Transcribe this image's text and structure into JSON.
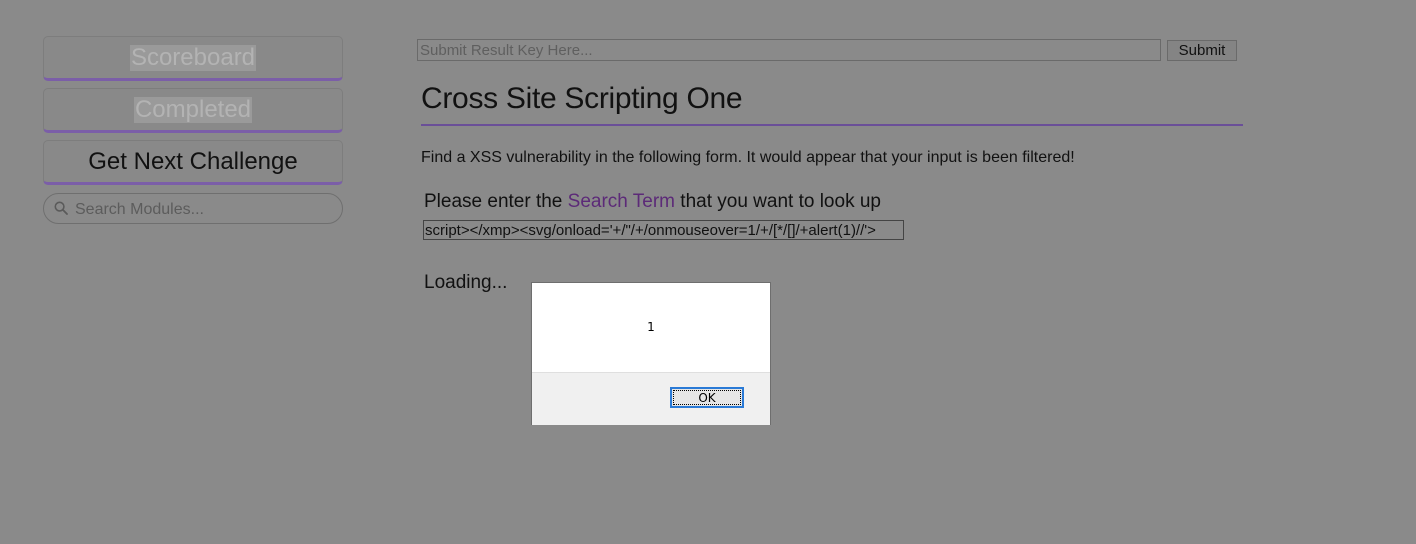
{
  "sidebar": {
    "scoreboard_label": "Scoreboard",
    "completed_label": "Completed",
    "next_challenge_label": "Get Next Challenge",
    "search_placeholder": "Search Modules...",
    "search_icon": "magnifier-icon"
  },
  "result_bar": {
    "placeholder": "Submit Result Key Here...",
    "submit_label": "Submit"
  },
  "challenge": {
    "title": "Cross Site Scripting One",
    "description": "Find a XSS vulnerability in the following form. It would appear that your input is been filtered!",
    "prompt_before": "Please enter the ",
    "prompt_highlight": "Search Term",
    "prompt_after": " that you want to look up",
    "input_value": "script></xmp><svg/onload='+/\"/+/onmouseover=1/+/[*/[]/+alert(1)//'>",
    "loading_text": "Loading..."
  },
  "alert_dialog": {
    "message": "1",
    "ok_label": "OK"
  },
  "colors": {
    "background": "#8a8a8a",
    "accent": "#7b5ea8",
    "highlight_text": "#5c2a78",
    "dialog_focus": "#2a7ad6"
  }
}
